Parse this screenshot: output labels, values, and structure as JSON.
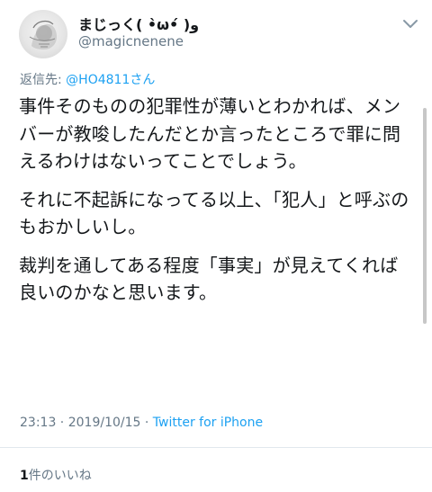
{
  "author": {
    "display_name": "まじっく( •̀ω•́ )و",
    "handle": "@magicnenene"
  },
  "reply": {
    "prefix": "返信先: ",
    "target": "@HO4811さん"
  },
  "tweet": {
    "paragraphs": [
      "事件そのものの犯罪性が薄いとわかれば、メンバーが教唆したんだとか言ったところで罪に問えるわけはないってことでしょう。",
      "それに不起訴になってる以上、「犯人」と呼ぶのもおかしいし。",
      "裁判を通してある程度「事実」が見えてくれば良いのかなと思います。"
    ]
  },
  "meta": {
    "time": "23:13",
    "sep1": " · ",
    "date": "2019/10/15",
    "sep2": " · ",
    "source": "Twitter for iPhone"
  },
  "likes": {
    "count": "1",
    "label": "件のいいね"
  },
  "icons": {
    "menu": "chevron-down-icon",
    "avatar": "avatar-illustration"
  }
}
